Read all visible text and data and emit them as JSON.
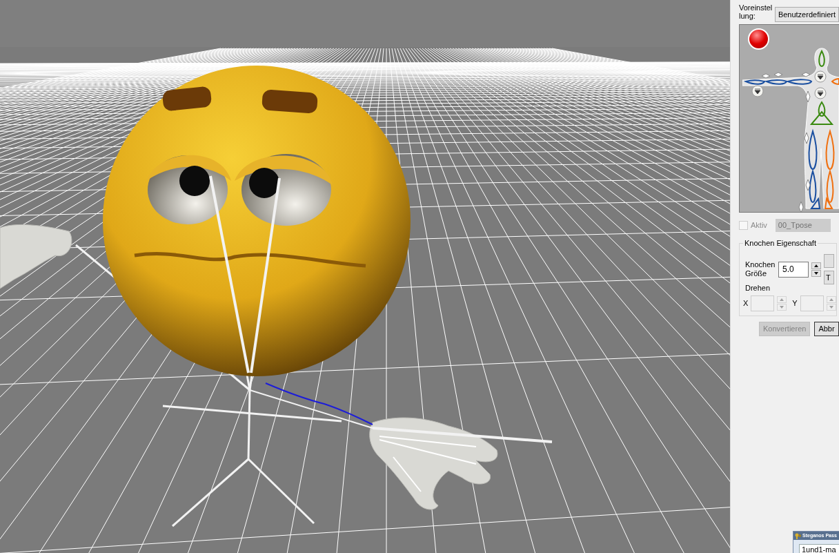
{
  "panel": {
    "preset": {
      "label": "Voreinstellung:",
      "value": "Benutzerdefiniert"
    },
    "aktiv": {
      "label": "Aktiv",
      "checked": false,
      "disabled": true
    },
    "pose_field": {
      "value": "00_Tpose",
      "disabled": true
    },
    "group": {
      "title": "Knochen Eigenschaft",
      "bone_size": {
        "label": "Knochen Größe",
        "value": "5.0"
      },
      "side_buttons": [
        {
          "kind": "blank"
        },
        {
          "kind": "text",
          "label": "T"
        }
      ],
      "rotate": {
        "label": "Drehen",
        "fields": [
          {
            "label": "X",
            "disabled": true
          },
          {
            "label": "Y",
            "disabled": true
          }
        ]
      }
    },
    "buttons": [
      {
        "label": "Konvertieren",
        "disabled": true
      },
      {
        "label": "Abbr",
        "disabled": false
      }
    ]
  },
  "taskbar_window": {
    "title": "Steganos Pass",
    "field": "1und1-ma"
  }
}
